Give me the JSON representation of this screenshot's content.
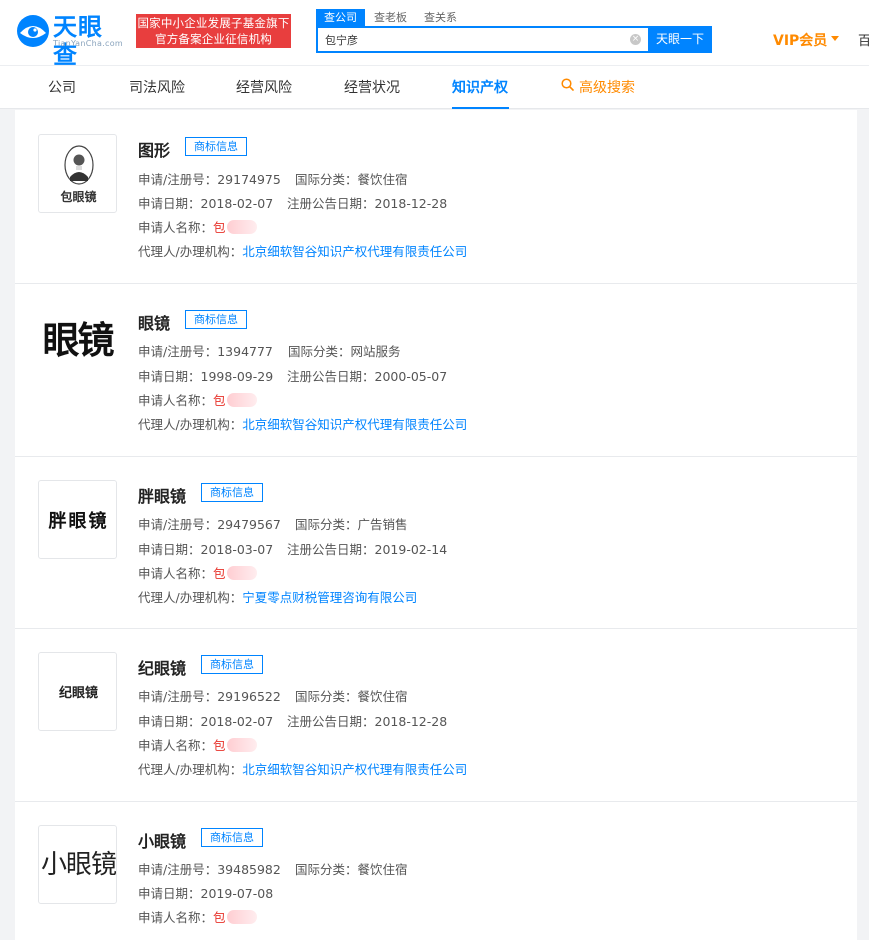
{
  "header": {
    "logo_cn": "天眼查",
    "logo_en": "TianYanCha.com",
    "badge_line1": "国家中小企业发展子基金旗下",
    "badge_line2": "官方备案企业征信机构",
    "search_tabs": [
      "查公司",
      "查老板",
      "查关系"
    ],
    "search_value": "包宁彦",
    "search_button": "天眼一下",
    "clear_icon": "×",
    "vip_label": "VIP会员",
    "cut_text": "百"
  },
  "nav": {
    "items": [
      "公司",
      "司法风险",
      "经营风险",
      "经营状况",
      "知识产权"
    ],
    "active_index": 4,
    "advanced_search": "高级搜索"
  },
  "labels": {
    "tag": "商标信息",
    "reg_no": "申请/注册号：",
    "intl_class": "国际分类：",
    "apply_date": "申请日期：",
    "notice_date": "注册公告日期：",
    "applicant": "申请人名称：",
    "agent": "代理人/办理机构："
  },
  "trademarks": [
    {
      "name": "图形",
      "thumb_text": "包眼镜",
      "reg_no": "29174975",
      "intl_class": "餐饮住宿",
      "apply_date": "2018-02-07",
      "notice_date": "2018-12-28",
      "applicant": "包",
      "agent": "北京细软智谷知识产权代理有限责任公司"
    },
    {
      "name": "眼镜",
      "thumb_text": "眼镜",
      "reg_no": "1394777",
      "intl_class": "网站服务",
      "apply_date": "1998-09-29",
      "notice_date": "2000-05-07",
      "applicant": "包",
      "agent": "北京细软智谷知识产权代理有限责任公司"
    },
    {
      "name": "胖眼镜",
      "thumb_text": "胖眼镜",
      "reg_no": "29479567",
      "intl_class": "广告销售",
      "apply_date": "2018-03-07",
      "notice_date": "2019-02-14",
      "applicant": "包",
      "agent": "宁夏零点财税管理咨询有限公司"
    },
    {
      "name": "纪眼镜",
      "thumb_text": "纪眼镜",
      "reg_no": "29196522",
      "intl_class": "餐饮住宿",
      "apply_date": "2018-02-07",
      "notice_date": "2018-12-28",
      "applicant": "包",
      "agent": "北京细软智谷知识产权代理有限责任公司"
    },
    {
      "name": "小眼镜",
      "thumb_text": "小眼镜",
      "reg_no": "39485982",
      "intl_class": "餐饮住宿",
      "apply_date": "2019-07-08",
      "applicant": "包"
    }
  ],
  "colors": {
    "brand_blue": "#0084ff",
    "badge_red": "#e83e3e",
    "vip_orange": "#ff8a00",
    "applicant_red": "#e8332b"
  },
  "icons": {
    "logo": "tianyancha-eye-logo-icon",
    "search_clear": "clear-icon",
    "advanced_search": "search-icon",
    "vip_dropdown": "caret-down-icon"
  }
}
